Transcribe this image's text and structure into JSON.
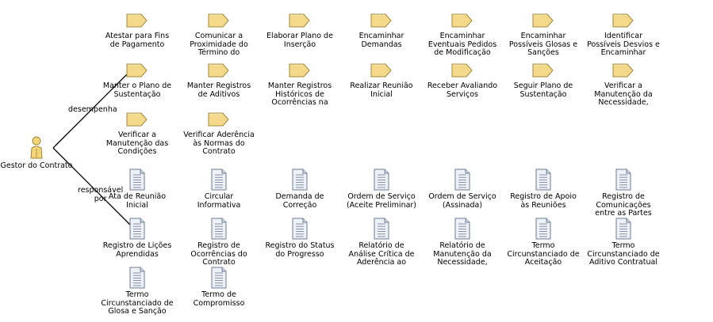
{
  "actor": {
    "name": "Gestor do Contrato",
    "icon": "actor-icon",
    "color": "#f5d57a"
  },
  "edges": [
    {
      "label": "desempenha"
    },
    {
      "label": "responsável\npor"
    }
  ],
  "activity_icon": "activity-folder-icon",
  "artifact_icon": "artifact-document-icon",
  "activities": [
    "Atestar para Fins\nde Pagamento",
    "Comunicar a\nProximidade do\nTérmino do",
    "Elaborar Plano de\nInserção",
    "Encaminhar\nDemandas",
    "Encaminhar\nEventuais Pedidos\nde Modificação",
    "Encaminhar\nPossíveis Glosas e\nSanções",
    "Identificar\nPossíveis Desvios e\nEncaminhar",
    "Manter o Plano de\nSustentação",
    "Manter Registros\nde Aditivos",
    "Manter Registros\nHistóricos de\nOcorrências na",
    "Realizar Reunião\nInicial",
    "Receber Avaliando\nServiços",
    "Seguir Plano de\nSustentação",
    "Verificar a\nManutenção da\nNecessidade,",
    "Verificar a\nManutenção das\nCondições",
    "Verificar Aderência\nàs Normas do\nContrato"
  ],
  "artifacts": [
    "Ata de Reunião\nInicial",
    "Circular\nInformativa",
    "Demanda de\nCorreção",
    "Ordem de Serviço\n(Aceite Preliminar)",
    "Ordem de Serviço\n(Assinada)",
    "Registro de Apoio\nàs Reuniões",
    "Registro de\nComunicações\nentre as Partes",
    "Registro de Lições\nAprendidas",
    "Registro de\nOcorrências do\nContrato",
    "Registro do Status\ndo Progresso",
    "Relatório de\nAnálise Crítica de\nAderência ao",
    "Relatório de\nManutenção da\nNecessidade,",
    "Termo\nCircunstanciado de\nAceitação",
    "Termo\nCircunstanciado de\nAditivo Contratual",
    "Termo\nCircunstanciado de\nGlosa e Sanção",
    "Termo de\nCompromisso"
  ],
  "colors": {
    "folder_fill": "#f5d98a",
    "folder_stroke": "#a08a3c",
    "doc_fill": "#eef1f6",
    "doc_stroke": "#6b7a94",
    "line": "#000000"
  }
}
